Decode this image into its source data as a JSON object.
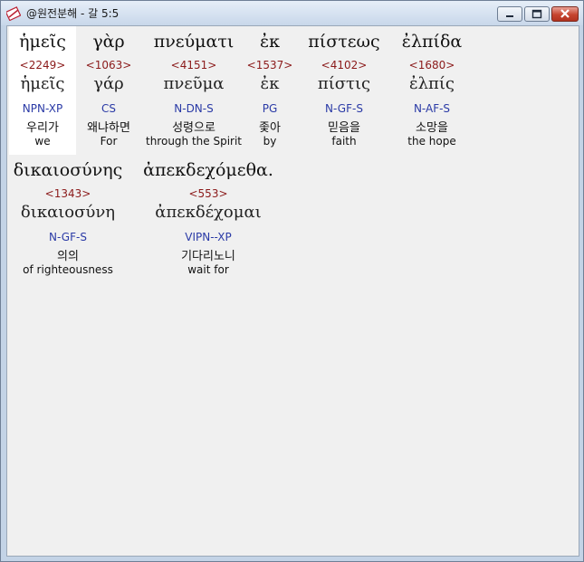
{
  "window": {
    "title": "@원전분해 - 갈 5:5"
  },
  "words": [
    {
      "surface": "ἡμεῖς",
      "strong": "<2249>",
      "lemma": "ἡμεῖς",
      "morph": "NPN-XP",
      "korean": "우리가",
      "english": "we"
    },
    {
      "surface": "γὰρ",
      "strong": "<1063>",
      "lemma": "γάρ",
      "morph": "CS",
      "korean": "왜냐하면",
      "english": "For"
    },
    {
      "surface": "πνεύματι",
      "strong": "<4151>",
      "lemma": "πνεῦμα",
      "morph": "N-DN-S",
      "korean": "성령으로",
      "english": "through the Spirit"
    },
    {
      "surface": "ἐκ",
      "strong": "<1537>",
      "lemma": "ἐκ",
      "morph": "PG",
      "korean": "좇아",
      "english": "by"
    },
    {
      "surface": "πίστεως",
      "strong": "<4102>",
      "lemma": "πίστις",
      "morph": "N-GF-S",
      "korean": "믿음을",
      "english": "faith"
    },
    {
      "surface": "ἐλπίδα",
      "strong": "<1680>",
      "lemma": "ἐλπίς",
      "morph": "N-AF-S",
      "korean": "소망을",
      "english": "the hope"
    },
    {
      "surface": "δικαιοσύνης",
      "strong": "<1343>",
      "lemma": "δικαιοσύνη",
      "morph": "N-GF-S",
      "korean": "의의",
      "english": "of righteousness"
    },
    {
      "surface": "ἀπεκδεχόμεθα.",
      "strong": "<553>",
      "lemma": "ἀπεκδέχομαι",
      "morph": "VIPN--XP",
      "korean": "기다리노니",
      "english": "wait for"
    }
  ]
}
